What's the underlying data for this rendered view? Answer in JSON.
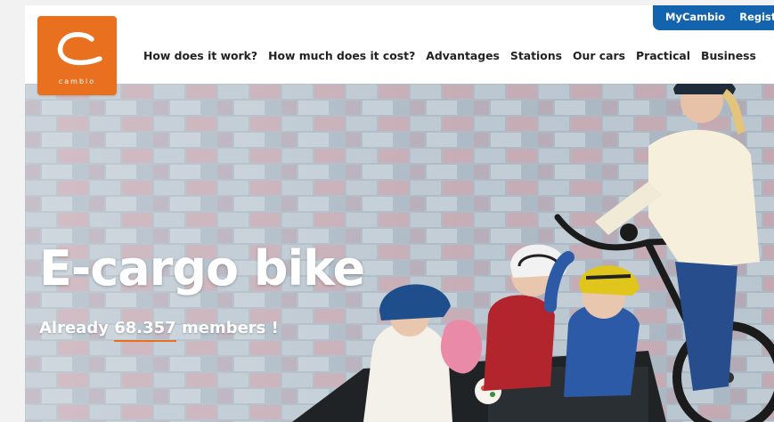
{
  "brand": {
    "logo_text": "cambio",
    "color_orange": "#e8701f",
    "color_blue": "#1463ae"
  },
  "header": {
    "nav": [
      "How does it work?",
      "How much does it cost?",
      "Advantages",
      "Stations",
      "Our cars",
      "Practical",
      "Business"
    ],
    "account_links": [
      "MyCambio",
      "Regist"
    ]
  },
  "hero": {
    "title": "E-cargo bike",
    "subtitle_prefix": "Already",
    "member_count": "68.357",
    "subtitle_suffix": "members !"
  }
}
